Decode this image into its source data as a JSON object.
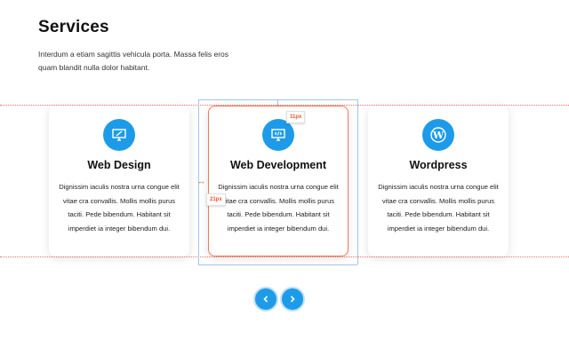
{
  "section": {
    "title": "Services",
    "description": "Interdum a etiam sagittis vehicula porta. Massa felis eros quam blandit nulla dolor habitant."
  },
  "cards": [
    {
      "icon": "monitor-pen-icon",
      "title": "Web Design",
      "text": "Dignissim iaculis nostra urna congue elit vitae cra convallis. Mollis mollis purus taciti. Pede bibendum. Habitant sit imperdiet ia integer bibendum dui."
    },
    {
      "icon": "monitor-code-icon",
      "title": "Web Development",
      "text": "Dignissim iaculis nostra urna congue elit vitae cra convallis. Mollis mollis purus taciti. Pede bibendum. Habitant sit imperdiet ia integer bibendum dui."
    },
    {
      "icon": "wordpress-icon",
      "title": "Wordpress",
      "text": "Dignissim iaculis nostra urna congue elit vitae cra convallis. Mollis mollis purus taciti. Pede bibendum. Habitant sit imperdiet ia integer bibendum dui."
    }
  ],
  "editor": {
    "top_spacing_label": "11px",
    "left_spacing_label": "21px"
  },
  "navigation": {
    "prev_icon": "chevron-left-icon",
    "next_icon": "chevron-right-icon"
  },
  "colors": {
    "accent": "#1e9be8",
    "selection": "#f07a5a",
    "guide": "#9fc5ec"
  }
}
